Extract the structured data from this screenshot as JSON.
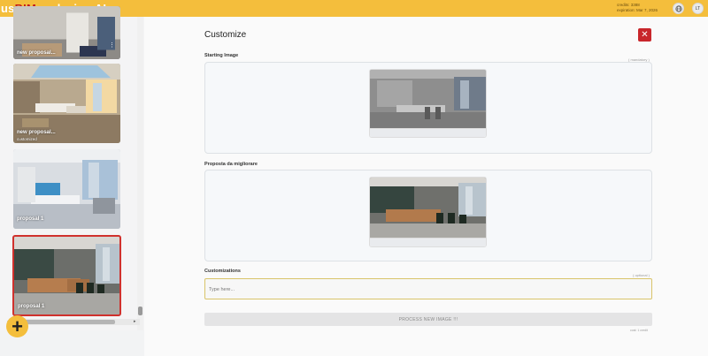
{
  "header": {
    "logo_part1": "us",
    "logo_part2": "BIM",
    "logo_part3": ".codesign AI",
    "credits": "credits: 3388",
    "expiration": "expiration: Mar 7, 2026",
    "user_initials": "LT"
  },
  "sidebar": {
    "cards": [
      {
        "title": "new proposal...",
        "subtitle": ""
      },
      {
        "title": "new proposal...",
        "subtitle": "customized"
      },
      {
        "title": "proposal 1",
        "subtitle": ""
      },
      {
        "title": "proposal 1",
        "subtitle": ""
      }
    ],
    "selected_index": 3,
    "add_icon": "plus-icon"
  },
  "panel": {
    "title": "Customize",
    "close_icon": "close-icon",
    "starting_image_label": "Starting Image",
    "starting_image_hint": "( mandatory )",
    "proposal_label": "Proposta da migliorare",
    "customizations_label": "Customizations",
    "customizations_hint": "( optional )",
    "customizations_placeholder": "Type here...",
    "process_label": "PROCESS NEW IMAGE !!!",
    "cost_note": "cost: 1 credit"
  },
  "colors": {
    "topbar": "#f4be3c",
    "accent_red": "#c8262b",
    "brand_red": "#c21d1d"
  }
}
